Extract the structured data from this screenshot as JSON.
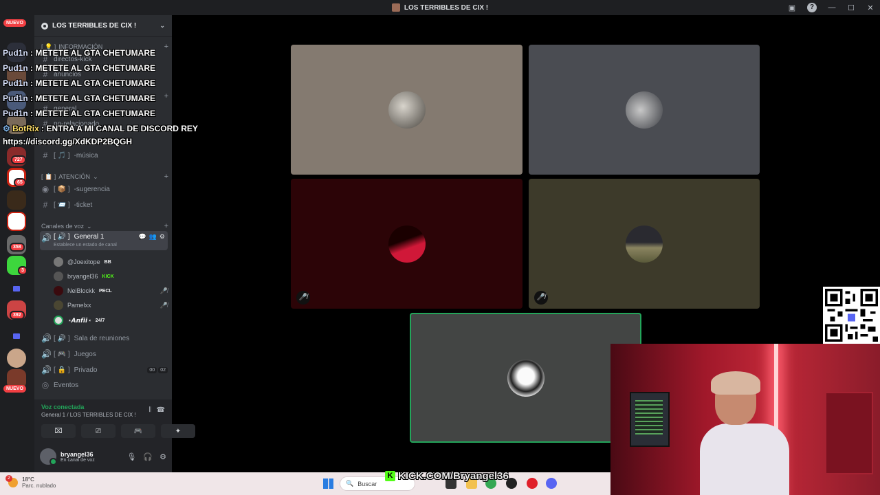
{
  "window": {
    "title": "LOS TERRIBLES DE CIX !"
  },
  "guild": {
    "name": "LOS TERRIBLES DE CIX !"
  },
  "rail": {
    "new_label": "NUEVO",
    "badges": [
      "727",
      "65",
      "358",
      "3",
      "392"
    ]
  },
  "categories": {
    "info": "INFORMACIÓN",
    "attention": "ATENCIÓN",
    "voice": "Canales de voz"
  },
  "text_channels": {
    "directos": "directos-kick",
    "anuncios": "anuncios",
    "general": "general",
    "norelacionado": "no-relacionado",
    "musica": "-música",
    "sugerencia": "-sugerencia",
    "ticket": "-ticket"
  },
  "voice_channels": {
    "general1": "General 1",
    "general1_status": "Establece un estado de canal",
    "sala": "Sala de reuniones",
    "juegos": "Juegos",
    "privado": "Privado",
    "privado_counts": [
      "00",
      "02"
    ],
    "eventos": "Eventos"
  },
  "voice_users": [
    {
      "name": "@Joexitope",
      "tag": "BB"
    },
    {
      "name": "bryangel36",
      "tag": "KICK"
    },
    {
      "name": "NeiBlockk",
      "tag": "PECL"
    },
    {
      "name": "Pamelxx",
      "tag": ""
    },
    {
      "name": "⋆𝘼𝙣𝙛𝙞𝙞⋆",
      "tag": "24/7"
    }
  ],
  "voice_panel": {
    "connected": "Voz conectada",
    "channel": "General 1 / LOS TERRIBLES DE CIX !"
  },
  "user": {
    "name": "bryangel36",
    "status": "En canal de voz"
  },
  "chat": [
    {
      "name": "Pud1n",
      "msg": ": METETE AL GTA CHETUMARE"
    },
    {
      "name": "Pud1n",
      "msg": ": METETE AL GTA CHETUMARE"
    },
    {
      "name": "Pud1n",
      "msg": ": METETE AL GTA CHETUMARE"
    },
    {
      "name": "Pud1n",
      "msg": ": METETE AL GTA CHETUMARE"
    },
    {
      "name": "Pud1n",
      "msg": ": METETE AL GTA CHETUMARE"
    },
    {
      "name": "BotRix",
      "msg": ": ENTRA A MI CANAL DE DISCORD REY"
    }
  ],
  "chat_link": "https://discord.gg/XdKDP2BQGH",
  "taskbar": {
    "temp": "18°C",
    "weather": "Parc. nublado",
    "weather_badge": "2",
    "search": "Buscar",
    "kick": "KICK.COM/Bryangel36"
  },
  "colors": {
    "tile1": "#847a70",
    "tile2": "#4a4c52",
    "tile3": "#2c0407",
    "tile4": "#3d3a2a",
    "tile5": "#434544",
    "speaking": "#23a55a"
  }
}
